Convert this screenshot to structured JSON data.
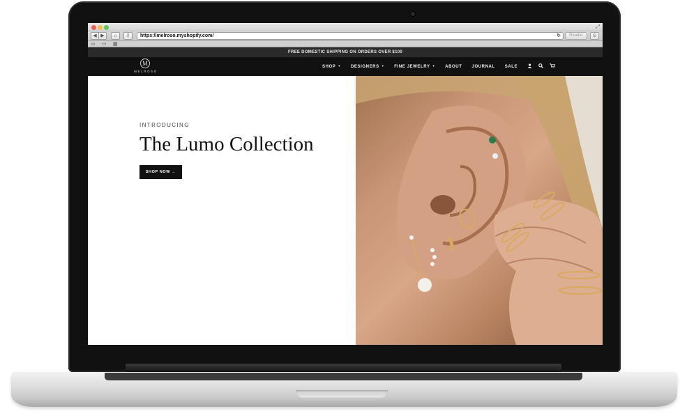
{
  "browser": {
    "url": "https://melroso.myshopify.com/",
    "reader_label": "Reader",
    "icons": {
      "back": "back-arrow-icon",
      "forward": "forward-arrow-icon",
      "home": "home-icon",
      "share": "share-icon",
      "reload": "reload-icon",
      "download": "download-icon",
      "reading_list": "glasses-icon",
      "bookmarks": "book-icon",
      "top_sites": "grid-icon"
    }
  },
  "site": {
    "promo_text": "FREE DOMESTIC SHIPPING ON ORDERS OVER $100",
    "logo_letter": "M",
    "logo_text": "MELROSO",
    "nav": [
      {
        "label": "SHOP",
        "caret": "▼"
      },
      {
        "label": "DESIGNERS",
        "caret": "▼"
      },
      {
        "label": "FINE JEWELRY",
        "caret": "▼"
      },
      {
        "label": "ABOUT",
        "caret": ""
      },
      {
        "label": "JOURNAL",
        "caret": ""
      },
      {
        "label": "SALE",
        "caret": ""
      }
    ],
    "nav_icons": [
      "account-icon",
      "search-icon",
      "cart-icon"
    ],
    "hero": {
      "eyebrow": "INTRODUCING",
      "title": "The Lumo Collection",
      "cta_label": "SHOP NOW →",
      "image_alt": "ear-with-gold-earrings-and-rings-photo"
    }
  },
  "colors": {
    "nav_bg": "#111111",
    "promo_bg": "#2a2a2a",
    "cta_bg": "#111111",
    "skin_tone": "#c99677",
    "gold": "#d9a962"
  }
}
